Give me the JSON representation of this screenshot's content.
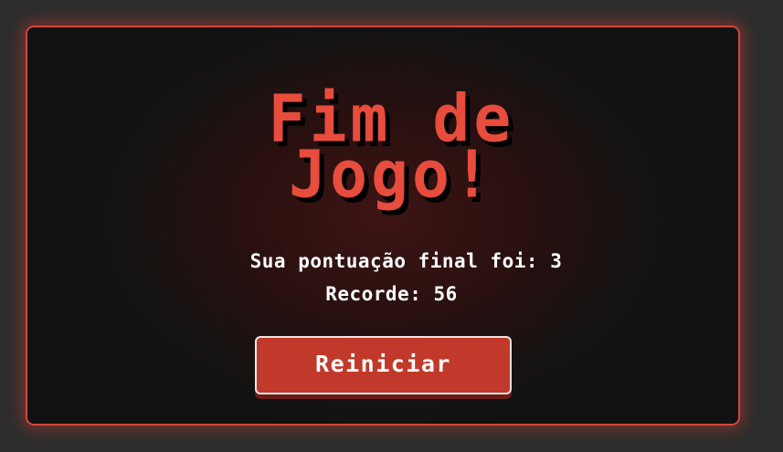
{
  "game_over": {
    "title": "Fim de Jogo!",
    "score_text": "Sua pontuação final foi: 3",
    "record_text": "Recorde: 56",
    "restart_label": "Reiniciar"
  },
  "colors": {
    "accent": "#e74c3c",
    "button": "#c0392b",
    "background": "#2d2d2d",
    "panel": "#111111",
    "text": "#ffffff"
  }
}
